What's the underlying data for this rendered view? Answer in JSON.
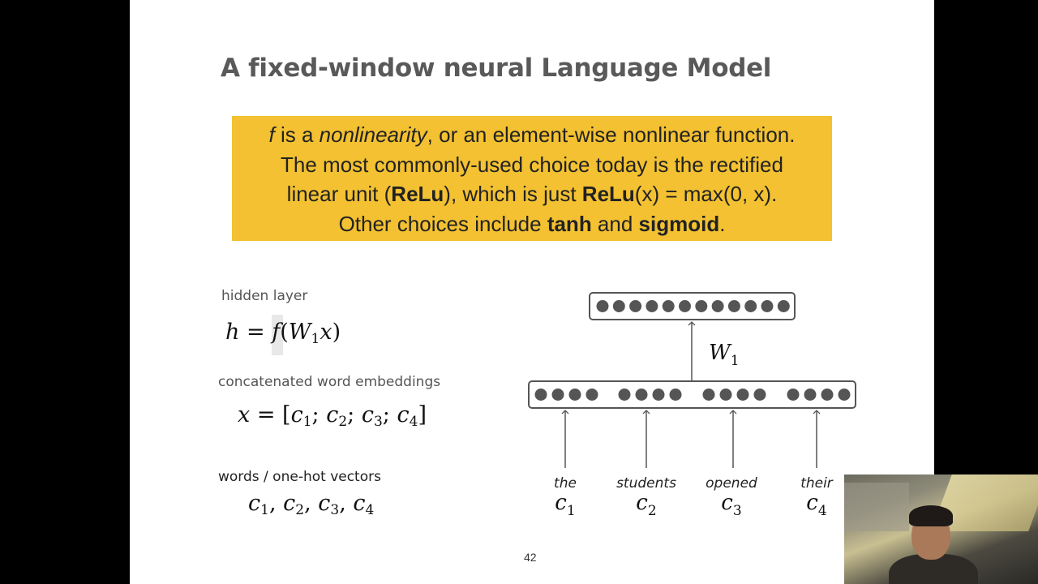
{
  "slide": {
    "title": "A fixed-window neural Language Model",
    "page_number": "42"
  },
  "callout": {
    "line1": {
      "f": "f",
      "a": " is a ",
      "nonlinearity": "nonlinearity",
      "b": ", or an element-wise nonlinear function."
    },
    "line2": "The most commonly-used choice today is the rectified",
    "line3": {
      "a": "linear unit (",
      "relu1": "ReLu",
      "b": "), which is just ",
      "relu2": "ReLu",
      "c": "(x) = max(0, x)."
    },
    "line4": {
      "a": "Other choices include ",
      "tanh": "tanh",
      "b": " and ",
      "sigmoid": "sigmoid",
      "c": "."
    }
  },
  "left_panel": {
    "hidden_label": "hidden layer",
    "hidden_eq": {
      "h": "h",
      "eq": " = ",
      "f": "f",
      "open": "(",
      "w": "W",
      "sub": "1",
      "x": "x",
      "close": ")"
    },
    "concat_label": "concatenated word embeddings",
    "concat_eq": {
      "x": "x",
      "eq": " = [",
      "c": "c",
      "s1": "1",
      "s2": "2",
      "s3": "3",
      "s4": "4",
      "sep": "; ",
      "close": "]"
    },
    "words_label": "words / one-hot vectors",
    "words_eq": {
      "c": "c",
      "s1": "1",
      "s2": "2",
      "s3": "3",
      "s4": "4",
      "sep": ", "
    }
  },
  "diagram": {
    "weight_label": "W",
    "weight_sub": "1",
    "hidden_units": 12,
    "embedding_groups": 4,
    "units_per_group": 4,
    "words": [
      {
        "word": "the",
        "var": "c",
        "sub": "1"
      },
      {
        "word": "students",
        "var": "c",
        "sub": "2"
      },
      {
        "word": "opened",
        "var": "c",
        "sub": "3"
      },
      {
        "word": "their",
        "var": "c",
        "sub": "4"
      }
    ]
  },
  "colors": {
    "callout_bg": "#f3c131",
    "title": "#595959",
    "unit_fill": "#555555",
    "box_stroke": "#555555"
  }
}
